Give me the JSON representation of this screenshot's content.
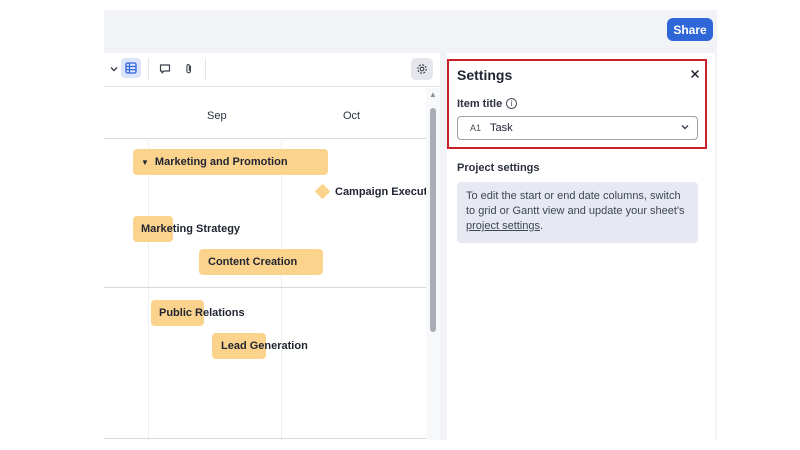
{
  "header": {
    "share_label": "Share"
  },
  "toolbar": {
    "chevron_icon": "chevron-down-icon",
    "grid_icon": "grid-view-icon",
    "comment_icon": "comment-icon",
    "attach_icon": "paperclip-icon",
    "settings_icon": "gear-icon"
  },
  "timeline": {
    "months": [
      "Sep",
      "Oct"
    ],
    "tasks": [
      {
        "label": "Marketing and Promotion",
        "type": "group"
      },
      {
        "label": "Campaign Executi",
        "type": "milestone"
      },
      {
        "label": "Marketing Strategy",
        "type": "task"
      },
      {
        "label": "Content Creation",
        "type": "task"
      },
      {
        "label": "Public Relations",
        "type": "task"
      },
      {
        "label": "Lead Generation",
        "type": "task"
      }
    ]
  },
  "settings": {
    "title": "Settings",
    "close_icon": "close-icon",
    "item_title_label": "Item title",
    "item_title_value": "Task",
    "item_title_type_icon": "A1",
    "project_settings_label": "Project settings",
    "info_text_before": "To edit the start or end date columns, switch to grid or Gantt view and update your sheet's ",
    "info_link": "project settings",
    "info_text_after": "."
  },
  "colors": {
    "accent": "#2f66d8",
    "bar": "#fbd38d",
    "highlight": "#c8202a"
  }
}
